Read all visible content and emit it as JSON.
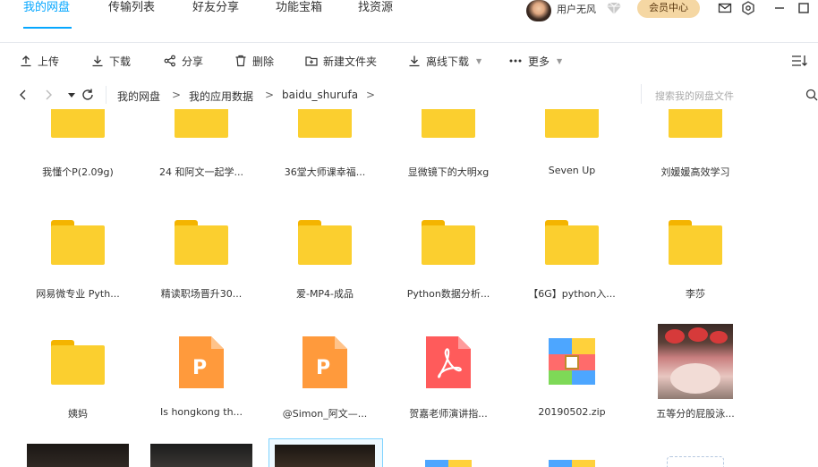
{
  "nav": {
    "tabs": [
      {
        "label": "我的网盘"
      },
      {
        "label": "传输列表"
      },
      {
        "label": "好友分享"
      },
      {
        "label": "功能宝箱"
      },
      {
        "label": "找资源"
      }
    ],
    "username": "用户无风",
    "vip_label": "会员中心"
  },
  "toolbar": {
    "upload": "上传",
    "download": "下载",
    "share": "分享",
    "delete": "删除",
    "new_folder": "新建文件夹",
    "offline_download": "离线下载",
    "more": "更多"
  },
  "path": {
    "crumbs": [
      "我的网盘",
      "我的应用数据",
      "baidu_shurufa"
    ],
    "search_placeholder": "搜索我的网盘文件"
  },
  "files": [
    {
      "name": "我懂个P(2.09g)",
      "type": "folder"
    },
    {
      "name": "24 和阿文一起学...",
      "type": "folder"
    },
    {
      "name": "36堂大师课幸福...",
      "type": "folder"
    },
    {
      "name": "显微镜下的大明xg",
      "type": "folder"
    },
    {
      "name": "Seven Up",
      "type": "folder"
    },
    {
      "name": "刘媛媛高效学习",
      "type": "folder"
    },
    {
      "name": "网易微专业 Pyth...",
      "type": "folder"
    },
    {
      "name": "精读职场晋升30...",
      "type": "folder"
    },
    {
      "name": "爱-MP4-成品",
      "type": "folder"
    },
    {
      "name": "Python数据分析...",
      "type": "folder"
    },
    {
      "name": "【6G】python入...",
      "type": "folder"
    },
    {
      "name": "李莎",
      "type": "folder"
    },
    {
      "name": "姨妈",
      "type": "folder"
    },
    {
      "name": "Is hongkong th...",
      "type": "ppt"
    },
    {
      "name": "@Simon_阿文—...",
      "type": "ppt"
    },
    {
      "name": "贺嘉老师演讲指...",
      "type": "pdf"
    },
    {
      "name": "20190502.zip",
      "type": "zip"
    },
    {
      "name": "五等分的屁股泳...",
      "type": "image"
    }
  ],
  "icons": {
    "ppt_letter": "P",
    "colors": {
      "accent": "#06a7ff",
      "folder": "#fbcf2f",
      "ppt": "#ff9a3c",
      "pdf": "#ff5b5b"
    }
  }
}
